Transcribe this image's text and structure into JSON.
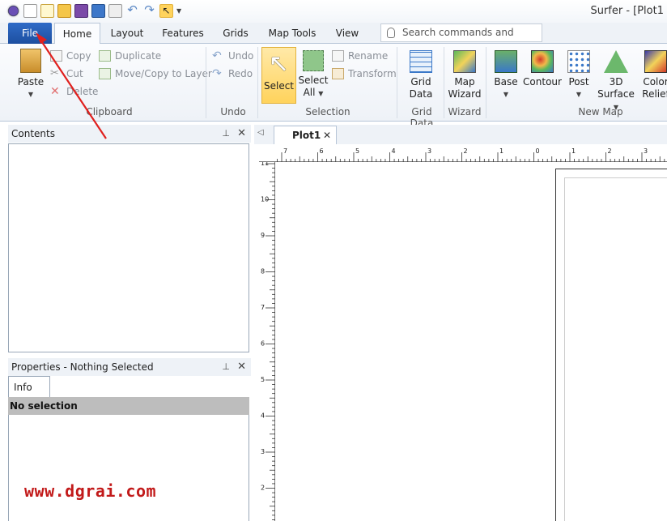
{
  "title_bar": {
    "app_title": "Surfer - [Plot1"
  },
  "tabs": [
    "File",
    "Home",
    "Layout",
    "Features",
    "Grids",
    "Map Tools",
    "View"
  ],
  "search": {
    "placeholder": "Search commands and Help..."
  },
  "ribbon": {
    "clipboard": {
      "paste": "Paste",
      "copy": "Copy",
      "cut": "Cut",
      "delete": "Delete",
      "duplicate": "Duplicate",
      "move_copy": "Move/Copy to Layer",
      "label": "Clipboard"
    },
    "undo": {
      "undo": "Undo",
      "redo": "Redo",
      "label": "Undo"
    },
    "selection": {
      "select": "Select",
      "select_all_1": "Select",
      "select_all_2": "All",
      "rename": "Rename",
      "transform": "Transform",
      "label": "Selection"
    },
    "grid_data": {
      "btn_1": "Grid",
      "btn_2": "Data",
      "label": "Grid Data"
    },
    "wizard": {
      "btn_1": "Map",
      "btn_2": "Wizard",
      "label": "Wizard"
    },
    "new_map": {
      "base": "Base",
      "contour": "Contour",
      "post": "Post",
      "surface_1": "3D",
      "surface_2": "Surface",
      "relief_1": "Color",
      "relief_2": "Relief",
      "label": "New Map"
    }
  },
  "contents_panel": {
    "title": "Contents"
  },
  "properties_panel": {
    "title": "Properties - Nothing Selected",
    "tab": "Info",
    "no_selection": "No selection"
  },
  "doc": {
    "tab": "Plot1"
  },
  "ruler": {
    "top_labels": [
      "7",
      "6",
      "5",
      "4",
      "3",
      "2",
      "1",
      "0",
      "1",
      "2",
      "3"
    ],
    "left_labels": [
      "11",
      "10",
      "9",
      "8",
      "7",
      "6",
      "5",
      "4",
      "3",
      "2"
    ]
  },
  "watermark": "www.dgrai.com",
  "colors": {
    "file_tab": "#2a62ba",
    "select_highlight": "#ffd35c",
    "annotation_arrow": "#e0201e"
  }
}
